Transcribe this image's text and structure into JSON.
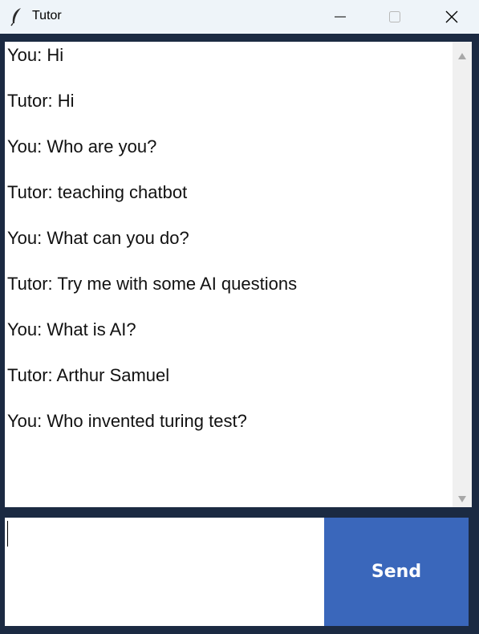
{
  "window": {
    "title": "Tutor",
    "icon": "feather-icon"
  },
  "chat": {
    "messages": [
      "You: Hi",
      "Tutor: Hi",
      "You: Who are you?",
      "Tutor: teaching chatbot",
      "You: What can you do?",
      "Tutor: Try me with some AI questions",
      "You: What is AI?",
      "Tutor: Arthur Samuel",
      "You: Who invented turing test?"
    ]
  },
  "input": {
    "value": ""
  },
  "send": {
    "label": "Send"
  },
  "colors": {
    "frame": "#1b2a42",
    "titlebar": "#eef4f9",
    "send_button": "#3a67bb",
    "panel": "#ffffff"
  }
}
